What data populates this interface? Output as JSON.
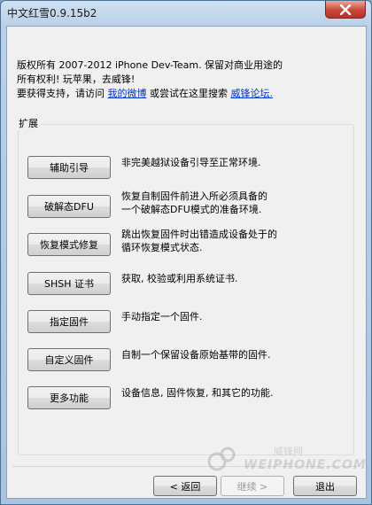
{
  "window": {
    "title": "中文红雪0.9.15b2",
    "close_label": "×"
  },
  "intro": {
    "line1": "版权所有 2007-2012 iPhone Dev-Team. 保留对商业用途的",
    "line2": "所有权利!    玩苹果，去威锋!",
    "support_prefix": "要获得支持，请访问 ",
    "link_weibo": "我的微博",
    "support_middle": " 或尝试在这里搜索 ",
    "link_forum": "威锋论坛."
  },
  "group": {
    "label": "扩展"
  },
  "items": [
    {
      "button": "辅助引导",
      "desc": [
        "非完美越狱设备引导至正常环境."
      ]
    },
    {
      "button": "破解态DFU",
      "desc": [
        "恢复自制固件前进入所必须具备的",
        "一个破解态DFU模式的准备环境."
      ]
    },
    {
      "button": "恢复模式修复",
      "desc": [
        "跳出恢复固件时出错造成设备处于的",
        "循环恢复模式状态."
      ]
    },
    {
      "button": "SHSH 证书",
      "desc": [
        "获取, 校验或利用系统证书."
      ]
    },
    {
      "button": "指定固件",
      "desc": [
        "手动指定一个固件."
      ]
    },
    {
      "button": "自定义固件",
      "desc": [
        "自制一个保留设备原始基带的固件."
      ]
    },
    {
      "button": "更多功能",
      "desc": [
        "设备信息, 固件恢复, 和其它的功能."
      ]
    }
  ],
  "watermark": {
    "text": "WEIPHONE.COM",
    "cn": "威锋网"
  },
  "footer": {
    "back": "< 返回",
    "next": "继续 >",
    "exit": "退出"
  }
}
